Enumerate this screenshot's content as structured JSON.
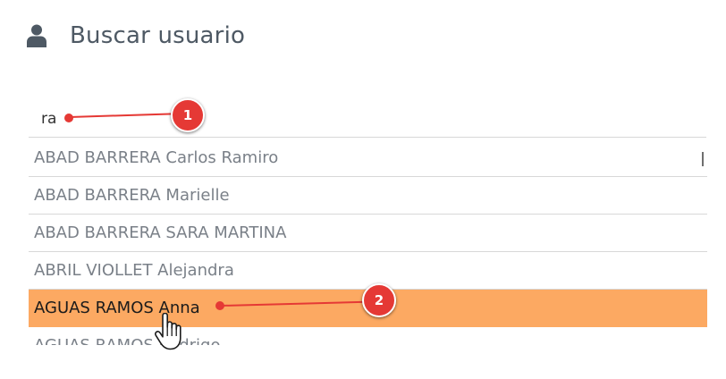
{
  "header": {
    "icon": "user-icon",
    "title": "Buscar usuario"
  },
  "search": {
    "value": "ra"
  },
  "results": [
    {
      "label": "ABAD BARRERA Carlos Ramiro"
    },
    {
      "label": "ABAD BARRERA Marielle"
    },
    {
      "label": "ABAD BARRERA SARA MARTINA"
    },
    {
      "label": "ABRIL VIOLLET Alejandra"
    },
    {
      "label": "AGUAS RAMOS Anna"
    },
    {
      "label": "AGUAS RAMOS Rodrigo"
    }
  ],
  "selected_index": 4,
  "annotations": {
    "step1": "1",
    "step2": "2"
  },
  "colors": {
    "selected_row": "#fca962",
    "annotation": "#e53935",
    "title": "#4e5964",
    "row_text": "#7a8088"
  }
}
